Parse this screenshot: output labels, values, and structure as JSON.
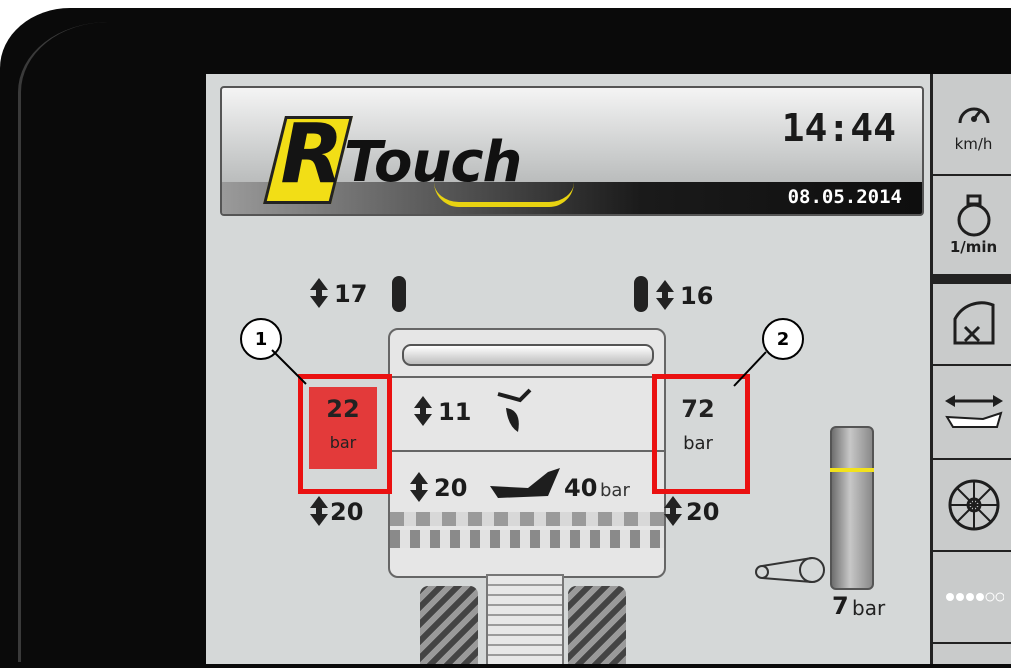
{
  "header": {
    "logo_letter": "R",
    "logo_text": "Touch",
    "time": "14:44",
    "date": "08.05.2014"
  },
  "sidebar": {
    "items": [
      {
        "icon": "speedometer-icon",
        "label": "km/h"
      },
      {
        "icon": "engine-icon",
        "label": "1/min"
      },
      {
        "icon": "steering-icon",
        "label": ""
      },
      {
        "icon": "width-adjust-icon",
        "label": ""
      },
      {
        "icon": "wheel-icon",
        "label": ""
      },
      {
        "icon": "dots-icon",
        "label": ""
      }
    ]
  },
  "left": {
    "top_value": "17",
    "pressure_value": "22",
    "pressure_unit": "bar",
    "bottom_value": "20",
    "callout": "1"
  },
  "right": {
    "top_value": "16",
    "pressure_value": "72",
    "pressure_unit": "bar",
    "bottom_value": "20",
    "callout": "2"
  },
  "machine": {
    "upper_value": "11",
    "lower_value": "20",
    "lower_pressure": "40",
    "lower_pressure_unit": "bar"
  },
  "gauge": {
    "value": "7",
    "unit": "bar"
  },
  "colors": {
    "alert_red": "#ea1111",
    "logo_yellow": "#f2de16"
  }
}
